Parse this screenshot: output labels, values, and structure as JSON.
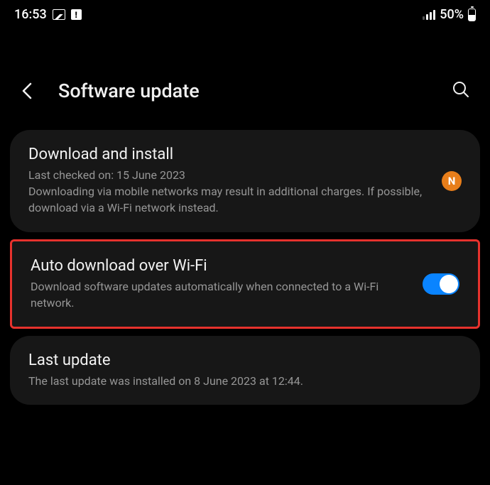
{
  "status_bar": {
    "time": "16:53",
    "battery_text": "50%"
  },
  "header": {
    "title": "Software update"
  },
  "cards": {
    "download_install": {
      "title": "Download and install",
      "last_checked": "Last checked on: 15 June 2023",
      "description": "Downloading via mobile networks may result in additional charges. If possible, download via a Wi-Fi network instead.",
      "badge": "N"
    },
    "auto_download": {
      "title": "Auto download over Wi-Fi",
      "description": "Download software updates automatically when connected to a Wi-Fi network.",
      "toggle_on": true
    },
    "last_update": {
      "title": "Last update",
      "description": "The last update was installed on 8 June 2023 at 12:44."
    }
  }
}
